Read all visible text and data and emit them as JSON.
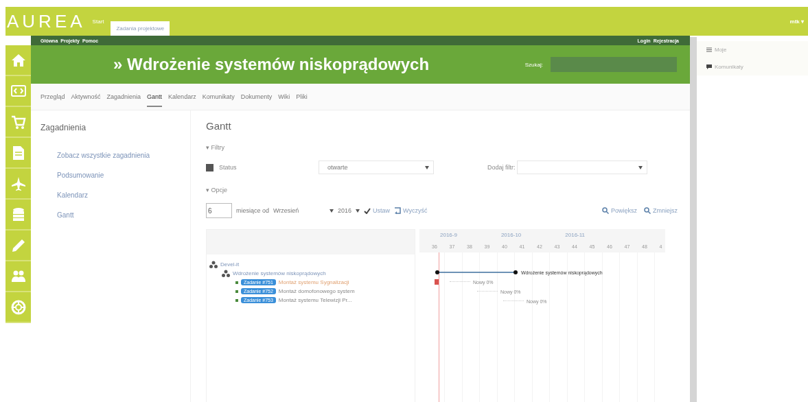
{
  "top_bar": {
    "logo": "AUREA",
    "home_link": "Start",
    "project_tab": "Zadania projektowe",
    "user_menu": "mtk ▾"
  },
  "menu_bar": {
    "left": [
      "Główna",
      "Projekty",
      "Pomoc"
    ],
    "right": [
      "Login",
      "Rejestracja"
    ]
  },
  "header": {
    "title": "» Wdrożenie systemów niskoprądowych",
    "search_label": "Szukaj:"
  },
  "tabs": [
    {
      "label": "Przegląd",
      "selected": false
    },
    {
      "label": "Aktywność",
      "selected": false
    },
    {
      "label": "Zagadnienia",
      "selected": false
    },
    {
      "label": "Gantt",
      "selected": true
    },
    {
      "label": "Kalendarz",
      "selected": false
    },
    {
      "label": "Komunikaty",
      "selected": false
    },
    {
      "label": "Dokumenty",
      "selected": false
    },
    {
      "label": "Wiki",
      "selected": false
    },
    {
      "label": "Pliki",
      "selected": false
    }
  ],
  "sidebar": {
    "title": "Zagadnienia",
    "links": [
      "Zobacz wszystkie zagadnienia",
      "Podsumowanie",
      "Kalendarz",
      "Gantt"
    ]
  },
  "content": {
    "title": "Gantt",
    "filters_legend": "▾ Filtry",
    "filter": {
      "label": "Status",
      "checked": true,
      "value": "otwarte"
    },
    "add_filter_label": "Dodaj filtr:",
    "options_legend": "▾ Opcje",
    "months": "6",
    "months_label": "miesiące od",
    "month": "Wrzesień",
    "year": "2016",
    "apply": "Ustaw",
    "clear": "Wyczyść",
    "zoom_in": "Powiększ",
    "zoom_out": "Zmniejsz"
  },
  "gantt": {
    "months": [
      "2016-9",
      "2016-10",
      "2016-11"
    ],
    "weeks": [
      "36",
      "37",
      "38",
      "39",
      "40",
      "41",
      "42",
      "43",
      "44",
      "45",
      "46",
      "47",
      "48",
      "4"
    ],
    "subjects": [
      {
        "kind": "group",
        "label": "Devel-it"
      },
      {
        "kind": "project",
        "label": "Wdrożenie systemów niskoprądowych"
      },
      {
        "kind": "issue",
        "tracker": "Zadanie #751",
        "subject": "Montaż systemu Sygnalizacji",
        "overdue": true
      },
      {
        "kind": "issue",
        "tracker": "Zadanie #752",
        "subject": "Montaż domofonowego system",
        "overdue": false
      },
      {
        "kind": "issue",
        "tracker": "Zadanie #753",
        "subject": "Montaż systemu Telewizji Pr...",
        "overdue": false
      }
    ],
    "bars": [
      {
        "kind": "project",
        "label": "Wdrożenie systemów niskoprądowych"
      },
      {
        "kind": "issue",
        "label": "Nowy 0%",
        "overdue": true
      },
      {
        "kind": "issue",
        "label": "Nowy 0%",
        "overdue": false
      },
      {
        "kind": "issue",
        "label": "Nowy 0%",
        "overdue": false
      }
    ]
  },
  "right_panel": {
    "items": [
      "Moje",
      "Komunikaty"
    ]
  }
}
